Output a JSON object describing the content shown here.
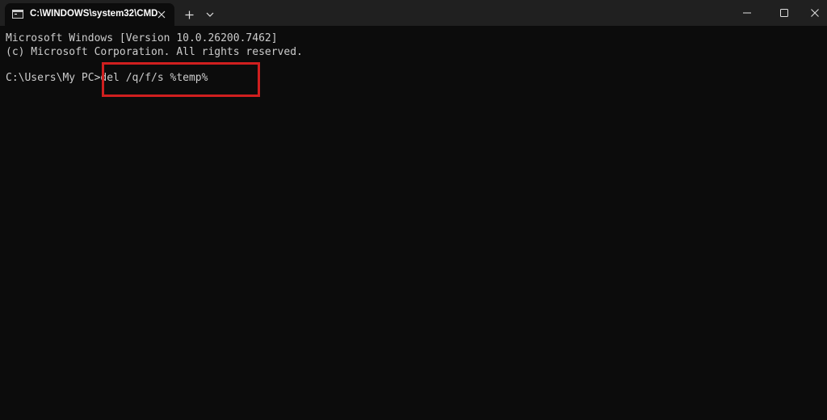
{
  "window": {
    "tab_title": "C:\\WINDOWS\\system32\\CMD",
    "icons": {
      "tab": "cmd-terminal-icon",
      "close_tab": "close-icon",
      "new_tab": "plus-icon",
      "dropdown": "chevron-down-icon",
      "minimize": "minimize-icon",
      "maximize": "maximize-icon",
      "close_window": "close-icon"
    }
  },
  "console": {
    "lines": [
      "Microsoft Windows [Version 10.0.26200.7462]",
      "(c) Microsoft Corporation. All rights reserved."
    ],
    "prompt": "C:\\Users\\My PC>",
    "command": "del /q/f/s %temp%"
  },
  "colors": {
    "background": "#0c0c0c",
    "titlebar": "#202020",
    "text": "#cccccc",
    "highlight": "#d01f1f"
  }
}
